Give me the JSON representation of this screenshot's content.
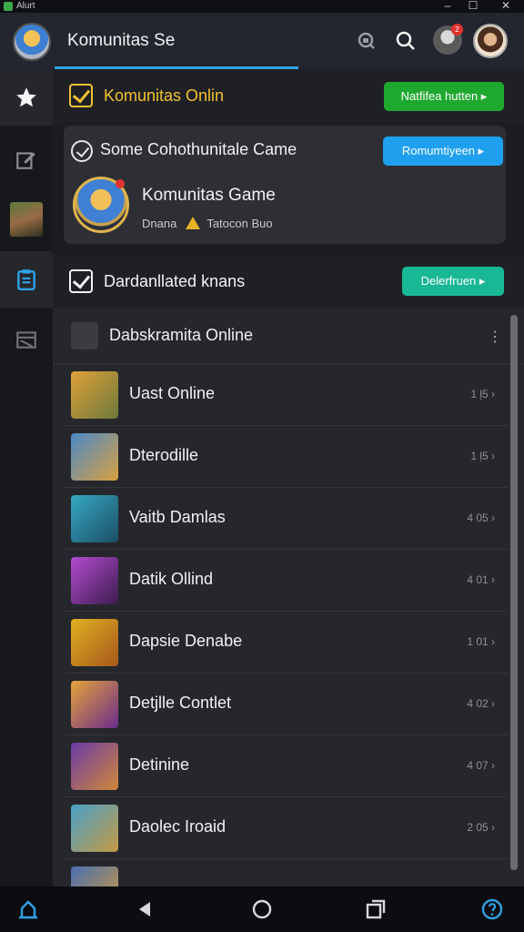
{
  "window": {
    "app_name": "Alurt",
    "controls": [
      "–",
      "☐",
      "✕"
    ]
  },
  "header": {
    "title": "Komunitas Se",
    "notification_badge": "2"
  },
  "section1": {
    "title": "Komunitas Onlin",
    "button_label": "Natfifea hutten ▸",
    "button_color": "#1fa82f"
  },
  "card": {
    "heading": "Some Cohothunitale Came",
    "button_label": "Romumtiyeen ▸",
    "button_color": "#1fa0ee",
    "game_name": "Komunitas Game",
    "meta_left": "Dnana",
    "meta_right": "Tatocon Buo"
  },
  "section2": {
    "title": "Dardanllated knans",
    "button_label": "Delerfruen ▸",
    "button_color": "#19b894"
  },
  "list": {
    "header_title": "Dabskramita Online",
    "rows": [
      {
        "name": "Uast Online",
        "meta": "1 ḷ5 ›",
        "colors": [
          "#e0a03a",
          "#6b7a3a"
        ]
      },
      {
        "name": "Dterodille",
        "meta": "1 ḷ5 ›",
        "colors": [
          "#4a89c8",
          "#d9a040"
        ]
      },
      {
        "name": "Vaitb Damlas",
        "meta": "4 05 ›",
        "colors": [
          "#35a9c2",
          "#1d4d66"
        ]
      },
      {
        "name": "Datik Ollind",
        "meta": "4 01 ›",
        "colors": [
          "#b44bd1",
          "#3b1c4f"
        ]
      },
      {
        "name": "Dapsie Denabe",
        "meta": "1 01 ›",
        "colors": [
          "#e0b020",
          "#a6591c"
        ]
      },
      {
        "name": "Detjlle Contlet",
        "meta": "4 02 ›",
        "colors": [
          "#e5a43a",
          "#6a2b8a"
        ]
      },
      {
        "name": "Detinine",
        "meta": "4 07 ›",
        "colors": [
          "#6a3aa6",
          "#d0883a"
        ]
      },
      {
        "name": "Daolec Iroaid",
        "meta": "2 05 ›",
        "colors": [
          "#4aa0c8",
          "#c49a44"
        ]
      },
      {
        "name": "",
        "meta": "",
        "colors": [
          "#4a6fb0",
          "#d09a3a"
        ]
      }
    ]
  },
  "accent_color": "#2fa3e6"
}
